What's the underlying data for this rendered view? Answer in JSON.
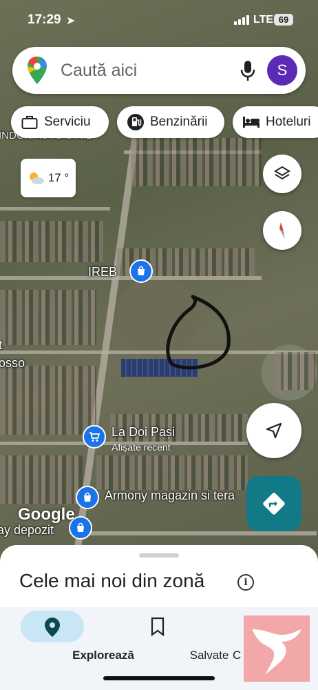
{
  "status_bar": {
    "time": "17:29",
    "network": "LTE",
    "battery": "69"
  },
  "search": {
    "placeholder": "Caută aici",
    "avatar_letter": "S"
  },
  "chips": [
    {
      "label": "Serviciu",
      "icon": "briefcase-icon"
    },
    {
      "label": "Benzinării",
      "icon": "fuel-icon"
    },
    {
      "label": "Hoteluri",
      "icon": "bed-icon"
    }
  ],
  "weather": {
    "temperature": "17 °",
    "icon": "partly-cloudy-icon"
  },
  "map_labels": {
    "ireb": "IREB",
    "la_doi_pasi": "La Doi Pași",
    "la_doi_pasi_sub": "Afișate recent",
    "armony": "Armony magazin si tera",
    "top_left": "INDOR AUTO S.R.L",
    "left_ossso": "osso",
    "left_t": "t",
    "ay_depozit": "ay depozit",
    "google": "Google"
  },
  "sheet": {
    "title": "Cele mai noi din zonă",
    "info_glyph": "i"
  },
  "bottom_nav": [
    {
      "label": "Explorează",
      "icon": "explore-pin-icon",
      "active": true
    },
    {
      "label": "Salvate",
      "icon": "bookmark-icon",
      "active": false
    },
    {
      "label": "C",
      "icon": "contribute-icon",
      "active": false
    }
  ],
  "colors": {
    "accent": "#1a73e8",
    "directions": "#127a87",
    "avatar": "#5b2bb8",
    "active_pill": "#c8e6f3"
  }
}
